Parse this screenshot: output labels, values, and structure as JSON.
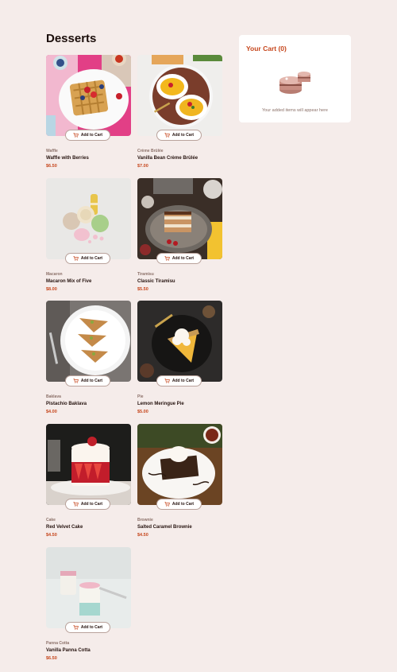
{
  "page": {
    "title": "Desserts"
  },
  "cart": {
    "title": "Your Cart (0)",
    "empty_text": "Your added items will appear here"
  },
  "colors": {
    "background": "#f5ecea",
    "accent": "#c6461c",
    "card": "#ffffff",
    "text": "#26130f",
    "muted": "#8c7169"
  },
  "products": [
    {
      "category": "Waffle",
      "name": "Waffle with Berries",
      "price": "$6.50",
      "button": "Add to Cart"
    },
    {
      "category": "Crème Brûlée",
      "name": "Vanilla Bean Crème Brûlée",
      "price": "$7.00",
      "button": "Add to Cart"
    },
    {
      "category": "Macaron",
      "name": "Macaron Mix of Five",
      "price": "$8.00",
      "button": "Add to Cart"
    },
    {
      "category": "Tiramisu",
      "name": "Classic Tiramisu",
      "price": "$5.50",
      "button": "Add to Cart"
    },
    {
      "category": "Baklava",
      "name": "Pistachio Baklava",
      "price": "$4.00",
      "button": "Add to Cart"
    },
    {
      "category": "Pie",
      "name": "Lemon Meringue Pie",
      "price": "$5.00",
      "button": "Add to Cart"
    },
    {
      "category": "Cake",
      "name": "Red Velvet Cake",
      "price": "$4.50",
      "button": "Add to Cart"
    },
    {
      "category": "Brownie",
      "name": "Salted Caramel Brownie",
      "price": "$4.50",
      "button": "Add to Cart"
    },
    {
      "category": "Panna Cotta",
      "name": "Vanilla Panna Cotta",
      "price": "$6.50",
      "button": "Add to Cart"
    }
  ],
  "icons": {
    "add_to_cart": "cart-plus-icon",
    "empty_cart": "cake-illustration"
  }
}
